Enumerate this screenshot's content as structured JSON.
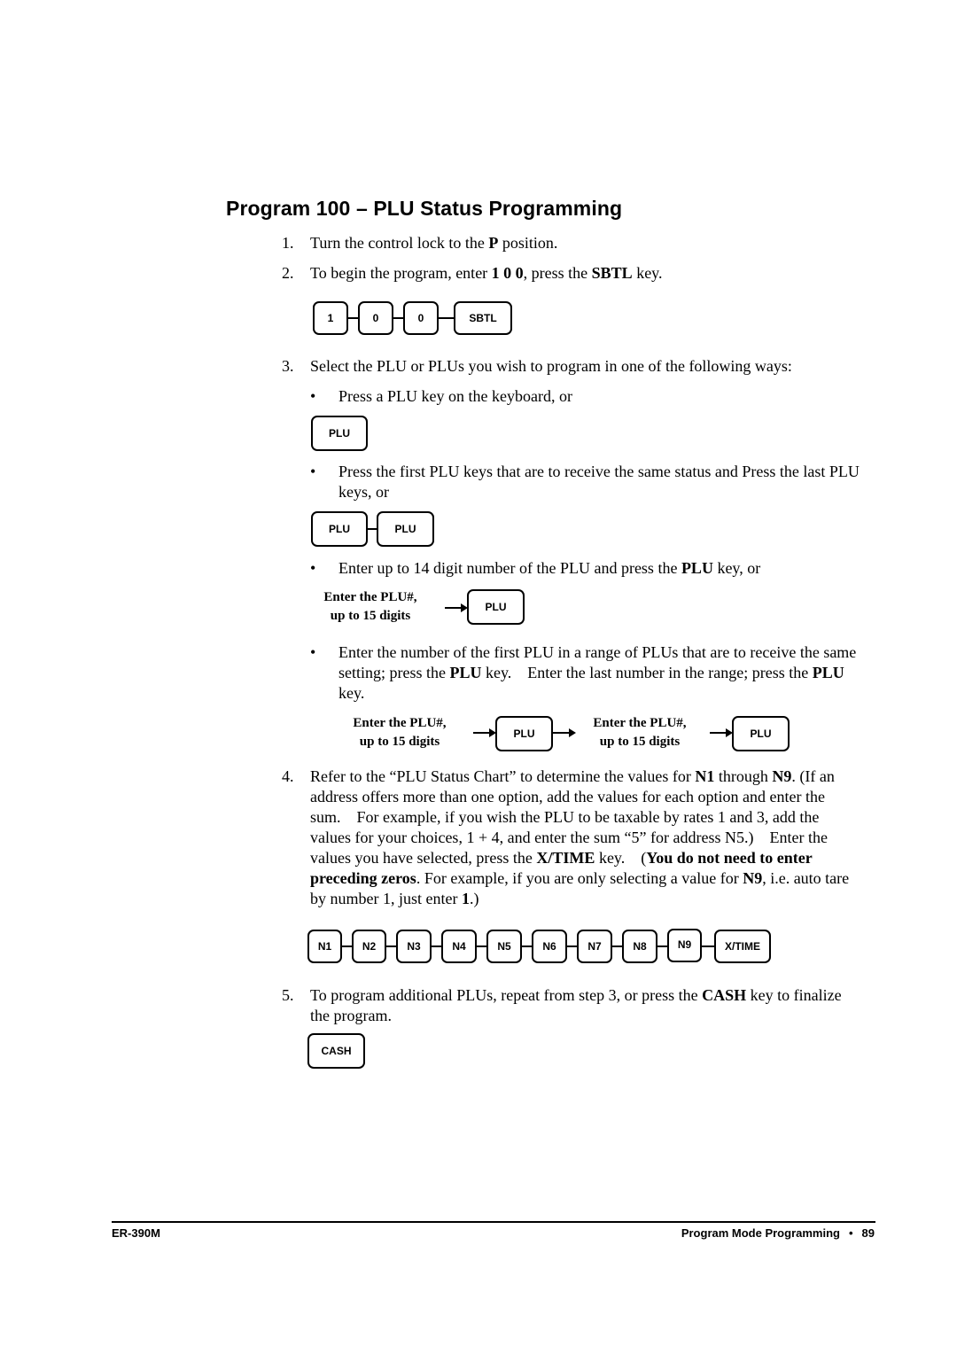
{
  "title": "Program 100 – PLU Status Programming",
  "steps": [
    {
      "num": "1.",
      "parts": [
        "Turn the control lock to the ",
        "P",
        " position."
      ]
    },
    {
      "num": "2.",
      "parts": [
        "To begin the program, enter ",
        "1 0 0",
        ", press the ",
        "SBTL",
        " key."
      ]
    },
    {
      "num": "3.",
      "text": "Select the PLU or PLUs you wish to program in one of the following ways:"
    },
    {
      "num": "4.",
      "parts": [
        "Refer to the “PLU Status Chart” to determine the values for ",
        "N1",
        " through ",
        "N9",
        ". (If an address offers more than one option, add the values for each option and enter the sum.    For example, if you wish the PLU to be taxable by rates 1 and 3, add the values for your choices, 1 + 4, and enter the sum “5” for address N5.)    Enter the values you have selected, press the ",
        "X/TIME",
        " key.    (",
        "You do not need to enter preceding zeros",
        ". For example, if you are only selecting a value for ",
        "N9",
        ", i.e. auto tare by number 1, just enter ",
        "1",
        ".)"
      ]
    },
    {
      "num": "5.",
      "parts": [
        "To program additional PLUs, repeat from step 3, or press the ",
        "CASH",
        " key to finalize the program."
      ]
    }
  ],
  "bullets": [
    {
      "text": "Press a PLU key on the keyboard, or"
    },
    {
      "text": "Press the first PLU keys that are to receive the same status and Press the last PLU keys, or"
    },
    {
      "parts": [
        "Enter up to 14 digit number of the PLU and press the ",
        "PLU",
        " key, or"
      ]
    },
    {
      "parts": [
        "Enter the number of the first PLU in a range of PLUs that are to receive the same setting; press the ",
        "PLU",
        " key.    Enter the last number in the range; press the ",
        "PLU",
        " key."
      ]
    }
  ],
  "sequences": {
    "start": [
      "1",
      "0",
      "0",
      "SBTL"
    ],
    "single_plu": [
      "PLU"
    ],
    "plu_range_keys": [
      "PLU",
      "PLU"
    ],
    "enter_plu": {
      "label_line1": "Enter the PLU#,",
      "label_line2": "up to 15 digits",
      "key": "PLU"
    },
    "enter_range": [
      {
        "label_line1": "Enter the PLU#,",
        "label_line2": "up to 15 digits",
        "key": "PLU"
      },
      {
        "label_line1": "Enter the PLU#,",
        "label_line2": "up to 15 digits",
        "key": "PLU"
      }
    ],
    "status": [
      "N1",
      "N2",
      "N3",
      "N4",
      "N5",
      "N6",
      "N7",
      "N8",
      "N9",
      "X/TIME"
    ],
    "finish": [
      "CASH"
    ]
  },
  "footer": {
    "left": "ER-390M",
    "section": "Program Mode Programming",
    "separator": "•",
    "page": "89"
  }
}
